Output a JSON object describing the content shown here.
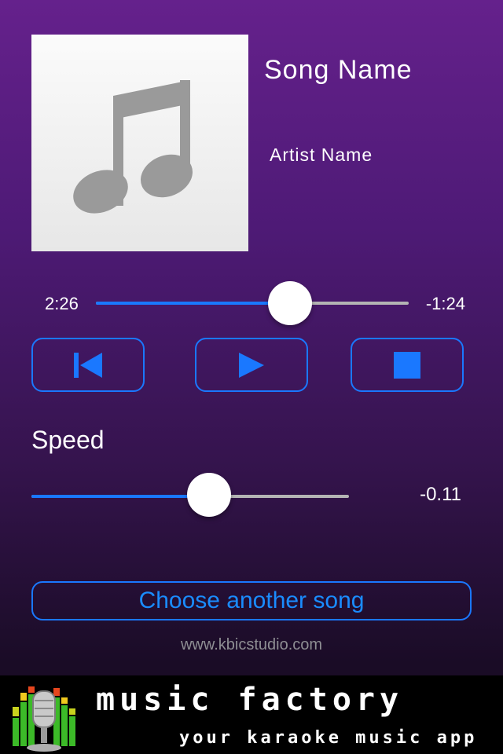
{
  "now_playing": {
    "song_name": "Song Name",
    "artist_name": "Artist Name",
    "artwork_icon": "music-note-icon"
  },
  "progress": {
    "elapsed": "2:26",
    "remaining": "-1:24",
    "fraction": 0.62
  },
  "controls": {
    "previous_icon": "skip-previous-icon",
    "play_icon": "play-icon",
    "stop_icon": "stop-icon"
  },
  "speed": {
    "label": "Speed",
    "value": "-0.11",
    "fraction": 0.56
  },
  "choose_button": {
    "label": "Choose another song"
  },
  "website": "www.kbicstudio.com",
  "banner": {
    "title": "music factory",
    "subtitle": "your karaoke music app",
    "logo_icon": "microphone-equalizer-icon"
  },
  "colors": {
    "accent": "#1a78ff",
    "track_inactive": "#b4b4b4",
    "background_top": "#65218c",
    "background_bottom": "#1a0c26"
  }
}
